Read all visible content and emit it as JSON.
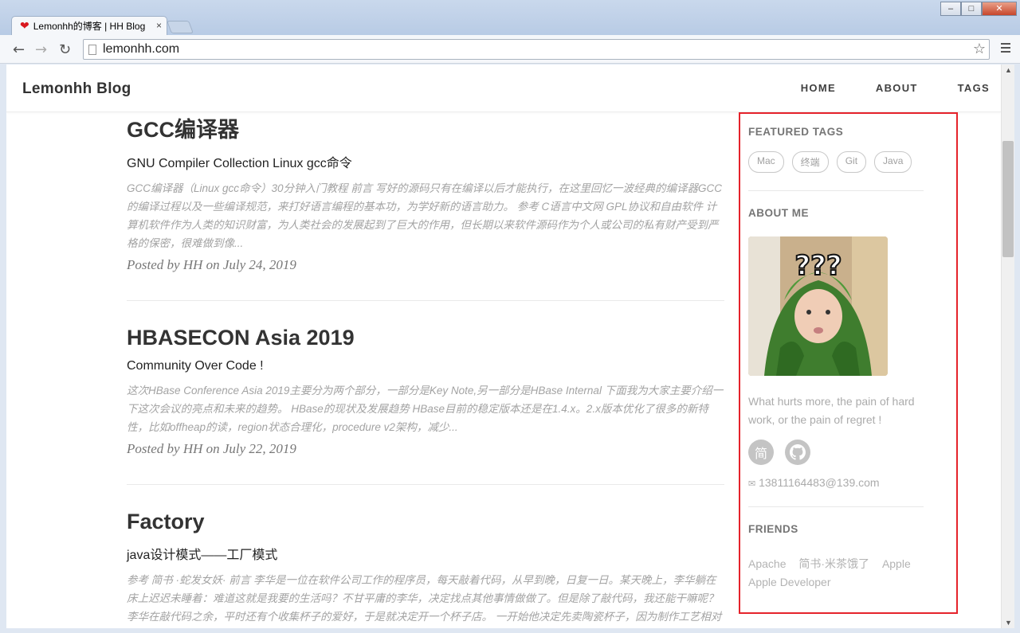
{
  "browser": {
    "tab_title": "Lemonhh的博客 | HH Blog",
    "url": "lemonhh.com",
    "close_glyph": "×",
    "min_glyph": "–",
    "max_glyph": "□",
    "win_close_glyph": "✕"
  },
  "site": {
    "brand": "Lemonhh Blog",
    "nav": [
      "HOME",
      "ABOUT",
      "TAGS"
    ]
  },
  "posts": [
    {
      "title": "GCC编译器",
      "subtitle": "GNU Compiler Collection Linux gcc命令",
      "excerpt": "GCC编译器（Linux gcc命令）30分钟入门教程 前言 写好的源码只有在编译以后才能执行，在这里回忆一波经典的编译器GCC的编译过程以及一些编译规范，来打好语言编程的基本功，为学好新的语言助力。 参考 C语言中文网 GPL协议和自由软件 计算机软件作为人类的知识财富，为人类社会的发展起到了巨大的作用，但长期以来软件源码作为个人或公司的私有财产受到严格的保密，很难做到像...",
      "meta": "Posted by HH on July 24, 2019"
    },
    {
      "title": "HBASECON Asia 2019",
      "subtitle": "Community Over Code !",
      "excerpt": "这次HBase Conference Asia 2019主要分为两个部分，一部分是Key Note,另一部分是HBase Internal 下面我为大家主要介绍一下这次会议的亮点和未来的趋势。 HBase的现状及发展趋势 HBase目前的稳定版本还是在1.4.x。2.x版本优化了很多的新特性，比如offheap的读，region状态合理化，procedure v2架构，减少...",
      "meta": "Posted by HH on July 22, 2019"
    },
    {
      "title": "Factory",
      "subtitle": "java设计模式——工厂模式",
      "excerpt": "参考 简书 ·蛇发女妖· 前言 李华是一位在软件公司工作的程序员，每天敲着代码，从早到晚，日复一日。某天晚上，李华躺在床上迟迟未睡着：难道这就是我要的生活吗？不甘平庸的李华，决定找点其他事情做做了。但是除了敲代码，我还能干嘛呢？李华在敲代码之余，平时还有个收集杯子的爱好，于是就决定开一个杯子店。 一开始他决定先卖陶瓷杯子，因为制作工艺相对简单，同人也有很多销路，脚明已经做的事件很快就...",
      "meta": ""
    }
  ],
  "sidebar": {
    "featured_title": "FEATURED TAGS",
    "tags": [
      "Mac",
      "终端",
      "Git",
      "Java"
    ],
    "about_title": "ABOUT ME",
    "avatar_caption": "???",
    "quote": "What hurts more, the pain of hard work, or the pain of regret !",
    "social": [
      "简",
      "github-icon"
    ],
    "email": "13811164483@139.com",
    "friends_title": "FRIENDS",
    "friends": [
      "Apache",
      "简书·米茶饿了",
      "Apple",
      "Apple Developer"
    ]
  },
  "colors": {
    "highlight_border": "#e5232b",
    "excerpt": "#a3a3a3",
    "title": "#333333"
  }
}
